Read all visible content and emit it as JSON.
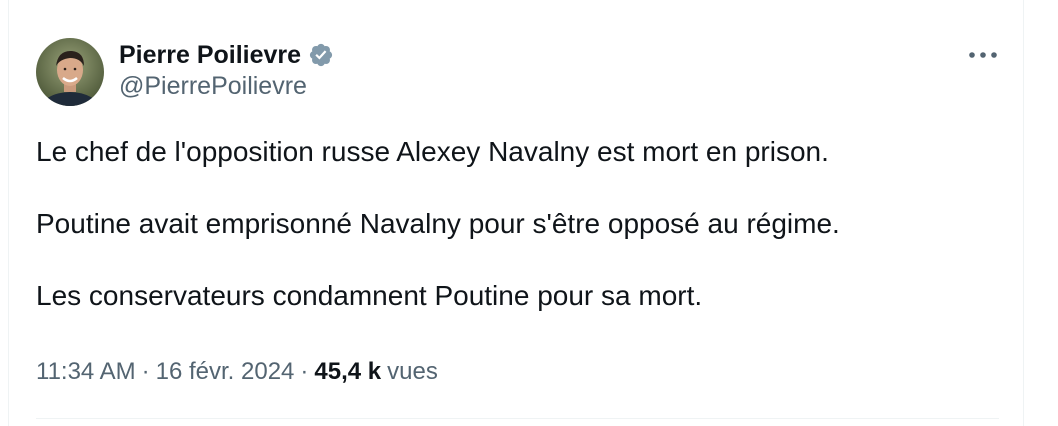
{
  "author": {
    "display_name": "Pierre Poilievre",
    "handle": "@PierrePoilievre",
    "verified_icon": "verified-badge-icon",
    "verified_color": "#829aab"
  },
  "menu": {
    "more_icon": "ellipsis-icon"
  },
  "tweet": {
    "paragraphs": [
      "Le chef de l'opposition russe Alexey Navalny est mort en prison.",
      "Poutine avait emprisonné Navalny pour s'être opposé au régime.",
      "Les conservateurs condamnent Poutine pour sa mort."
    ]
  },
  "meta": {
    "time": "11:34 AM",
    "separator": "·",
    "date": "16 févr. 2024",
    "views_count": "45,4 k",
    "views_label": "vues"
  },
  "colors": {
    "text_primary": "#0f1419",
    "text_secondary": "#536471",
    "border": "#eff3f4"
  }
}
